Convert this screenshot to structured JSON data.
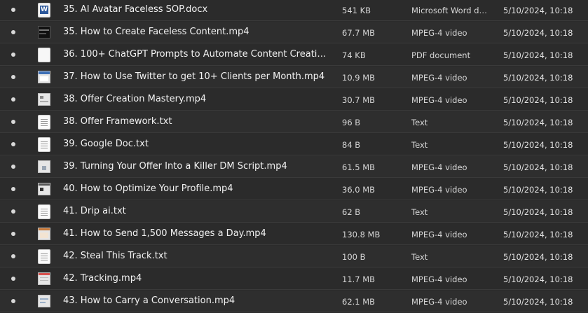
{
  "files": [
    {
      "name": "35. AI Avatar Faceless SOP.docx",
      "size": "541 KB",
      "type": "Microsoft Word do...",
      "modified": "5/10/2024, 10:18",
      "icon": "word-document-icon"
    },
    {
      "name": "35. How to Create Faceless Content.mp4",
      "size": "67.7 MB",
      "type": "MPEG-4 video",
      "modified": "5/10/2024, 10:18",
      "icon": "video-thumbnail-icon"
    },
    {
      "name": "36. 100+ ChatGPT Prompts to Automate Content Creation....",
      "size": "74 KB",
      "type": "PDF document",
      "modified": "5/10/2024, 10:18",
      "icon": "pdf-document-icon"
    },
    {
      "name": "37. How to Use Twitter to get 10+ Clients per Month.mp4",
      "size": "10.9 MB",
      "type": "MPEG-4 video",
      "modified": "5/10/2024, 10:18",
      "icon": "video-thumbnail-icon"
    },
    {
      "name": "38. Offer Creation Mastery.mp4",
      "size": "30.7 MB",
      "type": "MPEG-4 video",
      "modified": "5/10/2024, 10:18",
      "icon": "video-thumbnail-icon"
    },
    {
      "name": "38. Offer Framework.txt",
      "size": "96 B",
      "type": "Text",
      "modified": "5/10/2024, 10:18",
      "icon": "text-file-icon"
    },
    {
      "name": "39. Google Doc.txt",
      "size": "84 B",
      "type": "Text",
      "modified": "5/10/2024, 10:18",
      "icon": "text-file-icon"
    },
    {
      "name": "39. Turning Your Offer Into a Killer DM Script.mp4",
      "size": "61.5 MB",
      "type": "MPEG-4 video",
      "modified": "5/10/2024, 10:18",
      "icon": "video-thumbnail-icon"
    },
    {
      "name": "40. How to Optimize Your Profile.mp4",
      "size": "36.0 MB",
      "type": "MPEG-4 video",
      "modified": "5/10/2024, 10:18",
      "icon": "video-thumbnail-icon"
    },
    {
      "name": "41. Drip ai.txt",
      "size": "62 B",
      "type": "Text",
      "modified": "5/10/2024, 10:18",
      "icon": "text-file-icon"
    },
    {
      "name": "41. How to Send 1,500 Messages a Day.mp4",
      "size": "130.8 MB",
      "type": "MPEG-4 video",
      "modified": "5/10/2024, 10:18",
      "icon": "video-thumbnail-icon"
    },
    {
      "name": "42. Steal This Track.txt",
      "size": "100 B",
      "type": "Text",
      "modified": "5/10/2024, 10:18",
      "icon": "text-file-icon"
    },
    {
      "name": "42. Tracking.mp4",
      "size": "11.7 MB",
      "type": "MPEG-4 video",
      "modified": "5/10/2024, 10:18",
      "icon": "video-thumbnail-icon"
    },
    {
      "name": "43. How to Carry a Conversation.mp4",
      "size": "62.1 MB",
      "type": "MPEG-4 video",
      "modified": "5/10/2024, 10:18",
      "icon": "video-thumbnail-icon"
    }
  ],
  "colors": {
    "background": "#2b2b2b",
    "row_divider": "#3a3a3a",
    "text_primary": "#f2f2f2",
    "text_secondary": "#d6d6d6",
    "word_blue": "#2b579a"
  }
}
